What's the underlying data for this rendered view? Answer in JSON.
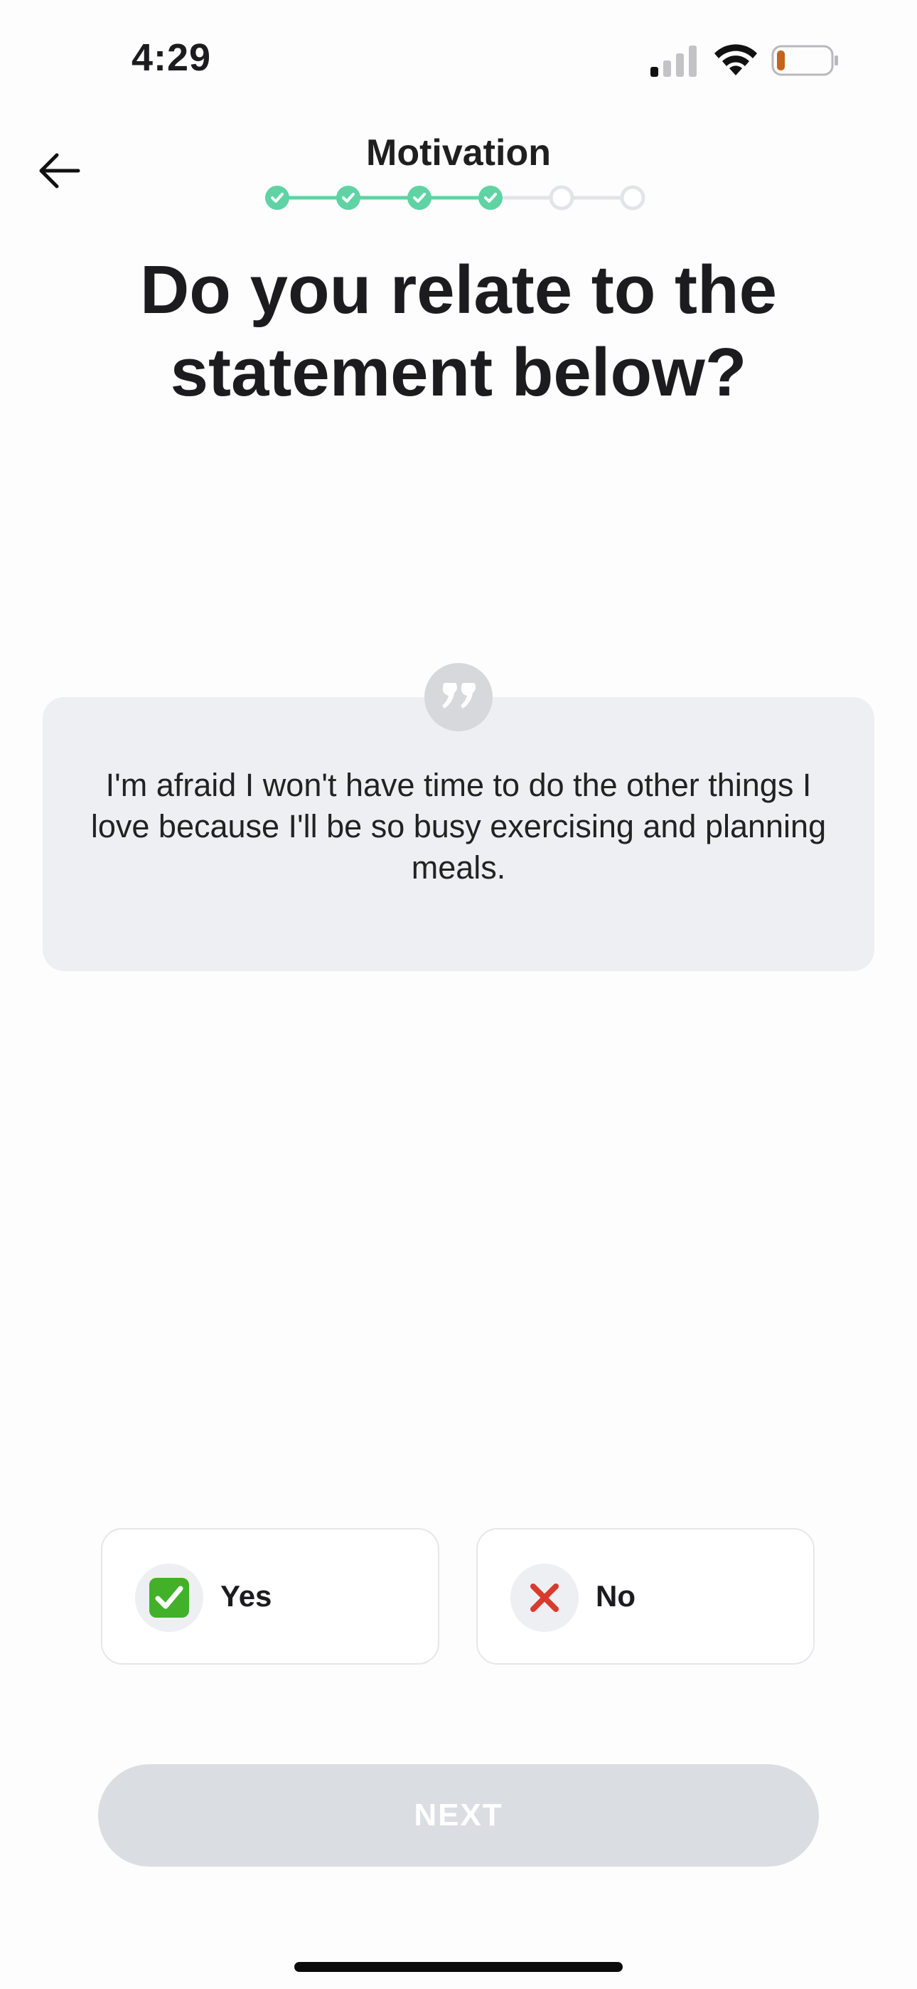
{
  "status_bar": {
    "time": "4:29",
    "signal_icon": "cellular-signal-icon",
    "wifi_icon": "wifi-icon",
    "battery_icon": "battery-low-icon",
    "battery_level": 0.15
  },
  "header": {
    "title": "Motivation",
    "back_icon": "arrow-left-icon",
    "progress": {
      "total_steps": 6,
      "completed_steps": 4,
      "active_color": "#5fd3a4",
      "inactive_color": "#e3e4e7"
    }
  },
  "question": {
    "title": "Do you relate to the statement below?"
  },
  "quote": {
    "icon": "quote-icon",
    "text": "I'm afraid I won't have time to do the other things I love because I'll be so busy exercising and planning meals."
  },
  "answers": {
    "yes": {
      "label": "Yes",
      "icon": "check-mark-icon",
      "icon_color": "#43b02a"
    },
    "no": {
      "label": "No",
      "icon": "cross-mark-icon",
      "icon_color": "#d93a2e"
    }
  },
  "next_button": {
    "label": "NEXT",
    "enabled": false
  }
}
